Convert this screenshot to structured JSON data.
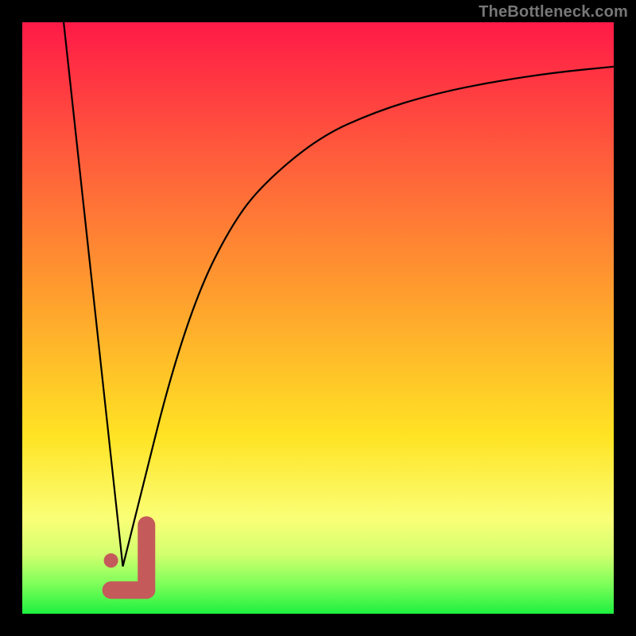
{
  "watermark": "TheBottleneck.com",
  "chart_data": {
    "type": "line",
    "title": "",
    "xlabel": "",
    "ylabel": "",
    "xlim": [
      0,
      100
    ],
    "ylim": [
      0,
      100
    ],
    "grid": false,
    "legend": false,
    "series": [
      {
        "name": "left-line",
        "x": [
          7,
          17
        ],
        "y": [
          100,
          8
        ]
      },
      {
        "name": "right-curve",
        "x": [
          17,
          20,
          25,
          30,
          35,
          40,
          50,
          60,
          70,
          80,
          90,
          100
        ],
        "y": [
          8,
          20,
          40,
          55,
          65,
          72,
          80.5,
          85,
          88,
          90,
          91.5,
          92.5
        ]
      }
    ],
    "marker": {
      "name": "j-marker",
      "x_range": [
        15,
        21
      ],
      "y_range": [
        4,
        15
      ],
      "dot": {
        "x": 15,
        "y": 9
      }
    },
    "background": {
      "type": "vertical-gradient",
      "stops": [
        {
          "pos": 0,
          "color": "#ff1a47"
        },
        {
          "pos": 0.22,
          "color": "#ff5a3c"
        },
        {
          "pos": 0.45,
          "color": "#ff9b2e"
        },
        {
          "pos": 0.7,
          "color": "#ffe324"
        },
        {
          "pos": 0.84,
          "color": "#faff77"
        },
        {
          "pos": 0.9,
          "color": "#d2ff6e"
        },
        {
          "pos": 0.95,
          "color": "#7dff5a"
        },
        {
          "pos": 1.0,
          "color": "#1ef03f"
        }
      ]
    }
  }
}
